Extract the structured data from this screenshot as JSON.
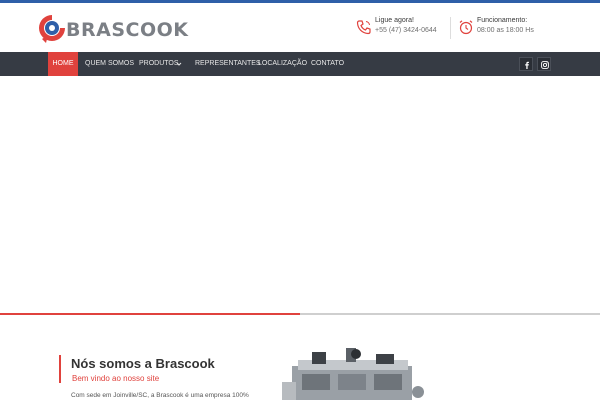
{
  "colors": {
    "accent": "#e0423d",
    "navbar": "#363b44",
    "top_strip": "#2f5fa8"
  },
  "header": {
    "logo_text": "BRASCOOK",
    "phone": {
      "icon": "phone-icon",
      "label": "Ligue agora!",
      "value": "+55 (47) 3424-0644"
    },
    "hours": {
      "icon": "alarm-clock-icon",
      "label": "Funcionamento:",
      "value": "08:00 as 18:00 Hs"
    }
  },
  "nav": {
    "items": [
      {
        "label": "HOME",
        "active": true
      },
      {
        "label": "QUEM SOMOS"
      },
      {
        "label": "PRODUTOS",
        "has_submenu": true
      },
      {
        "label": "REPRESENTANTES"
      },
      {
        "label": "LOCALIZAÇÃO"
      },
      {
        "label": "CONTATO"
      }
    ],
    "social": [
      {
        "icon": "facebook-icon"
      },
      {
        "icon": "instagram-icon"
      }
    ]
  },
  "slider": {
    "progress": 0.5
  },
  "about": {
    "title": "Nós somos a Brascook",
    "subtitle": "Bem vindo ao nosso site",
    "text": "Com sede em Joinville/SC, a Brascook é uma empresa 100%"
  }
}
